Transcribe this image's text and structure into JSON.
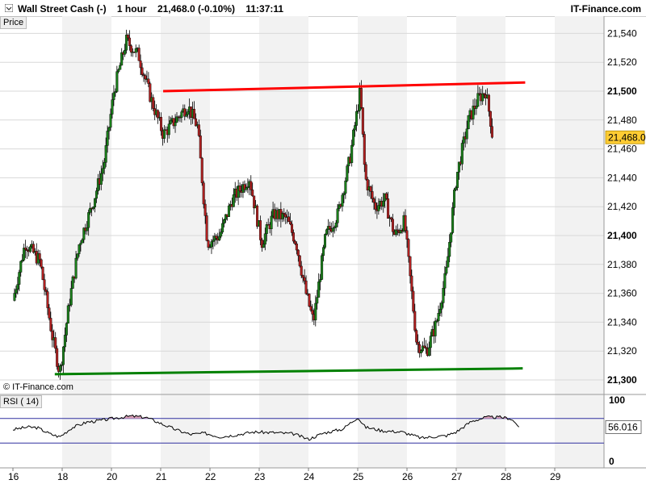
{
  "header": {
    "instrument": "Wall Street Cash (-)",
    "timeframe": "1 hour",
    "last_quote": "21,468.0 (-0.10%)",
    "time": "11:37:11",
    "brand": "IT-Finance.com"
  },
  "panels": {
    "price_label": "Price",
    "rsi_label": "RSI ( 14)",
    "copyright": "© IT-Finance.com"
  },
  "colors": {
    "up_candle": "#1a7f1a",
    "down_candle": "#b02020",
    "resistance": "#ff0000",
    "support": "#008000",
    "rsi_line": "#000000",
    "rsi_fill": "#d9a0b8",
    "rsi_band": "#3030a0",
    "last_price_badge": "#ffcc33",
    "session_shade": "#f2f2f2",
    "grid": "#d8d8d8"
  },
  "chart_data": [
    {
      "type": "candlestick",
      "title": "",
      "ylabel": "",
      "ylim": [
        21290,
        21555
      ],
      "y_ticks": [
        21300,
        21320,
        21340,
        21360,
        21380,
        21400,
        21420,
        21440,
        21460,
        21480,
        21500,
        21520,
        21540
      ],
      "y_tick_labels": [
        "21,300",
        "21,320",
        "21,340",
        "21,360",
        "21,380",
        "21,400",
        "21,420",
        "21,440",
        "21,460",
        "21,480",
        "21,500",
        "21,520",
        "21,540"
      ],
      "bold_ticks": [
        21300,
        21400,
        21500
      ],
      "x_ticks": [
        "16",
        "18",
        "20",
        "21",
        "22",
        "23",
        "24",
        "25",
        "26",
        "27",
        "28",
        "29"
      ],
      "x_range": [
        0,
        12
      ],
      "last_price": 21468.0,
      "last_price_label": "21,468.0",
      "path": [
        [
          0.0,
          21355
        ],
        [
          0.25,
          21395
        ],
        [
          0.55,
          21382
        ],
        [
          0.8,
          21330
        ],
        [
          0.95,
          21305
        ],
        [
          1.15,
          21355
        ],
        [
          1.35,
          21395
        ],
        [
          1.6,
          21420
        ],
        [
          1.85,
          21450
        ],
        [
          2.05,
          21500
        ],
        [
          2.3,
          21535
        ],
        [
          2.55,
          21525
        ],
        [
          2.8,
          21495
        ],
        [
          3.05,
          21470
        ],
        [
          3.3,
          21480
        ],
        [
          3.55,
          21490
        ],
        [
          3.75,
          21475
        ],
        [
          3.95,
          21395
        ],
        [
          4.2,
          21400
        ],
        [
          4.45,
          21425
        ],
        [
          4.8,
          21440
        ],
        [
          5.05,
          21395
        ],
        [
          5.3,
          21415
        ],
        [
          5.55,
          21412
        ],
        [
          5.75,
          21395
        ],
        [
          5.95,
          21360
        ],
        [
          6.1,
          21340
        ],
        [
          6.35,
          21400
        ],
        [
          6.6,
          21415
        ],
        [
          6.85,
          21455
        ],
        [
          7.05,
          21500
        ],
        [
          7.15,
          21440
        ],
        [
          7.35,
          21420
        ],
        [
          7.55,
          21425
        ],
        [
          7.75,
          21400
        ],
        [
          7.95,
          21410
        ],
        [
          8.05,
          21375
        ],
        [
          8.2,
          21325
        ],
        [
          8.4,
          21320
        ],
        [
          8.6,
          21340
        ],
        [
          8.8,
          21375
        ],
        [
          9.0,
          21440
        ],
        [
          9.25,
          21480
        ],
        [
          9.45,
          21495
        ],
        [
          9.6,
          21500
        ],
        [
          9.75,
          21468
        ]
      ],
      "trendlines": [
        {
          "name": "resistance",
          "from": [
            3.05,
            21500
          ],
          "to": [
            10.4,
            21506
          ]
        },
        {
          "name": "support",
          "from": [
            0.85,
            21304
          ],
          "to": [
            10.35,
            21308
          ]
        }
      ]
    },
    {
      "type": "line",
      "title": "",
      "ylabel": "",
      "ylim": [
        0,
        100
      ],
      "y_ticks": [
        0,
        100
      ],
      "y_tick_labels": [
        "0",
        "100"
      ],
      "bands": [
        30,
        70
      ],
      "last_value": 56.016,
      "last_value_label": "56.016",
      "path": [
        [
          0.0,
          52
        ],
        [
          0.3,
          56
        ],
        [
          0.5,
          55
        ],
        [
          0.75,
          45
        ],
        [
          0.95,
          40
        ],
        [
          1.2,
          55
        ],
        [
          1.5,
          64
        ],
        [
          1.8,
          67
        ],
        [
          2.1,
          71
        ],
        [
          2.4,
          74
        ],
        [
          2.7,
          72
        ],
        [
          3.0,
          62
        ],
        [
          3.3,
          52
        ],
        [
          3.6,
          44
        ],
        [
          3.9,
          46
        ],
        [
          4.2,
          40
        ],
        [
          4.5,
          43
        ],
        [
          4.9,
          48
        ],
        [
          5.3,
          47
        ],
        [
          5.7,
          45
        ],
        [
          6.0,
          36
        ],
        [
          6.3,
          46
        ],
        [
          6.7,
          53
        ],
        [
          7.0,
          72
        ],
        [
          7.15,
          56
        ],
        [
          7.5,
          50
        ],
        [
          7.9,
          48
        ],
        [
          8.3,
          38
        ],
        [
          8.5,
          40
        ],
        [
          8.8,
          42
        ],
        [
          9.0,
          48
        ],
        [
          9.3,
          65
        ],
        [
          9.6,
          72
        ],
        [
          9.9,
          72
        ],
        [
          10.1,
          70
        ],
        [
          10.3,
          56
        ]
      ]
    }
  ]
}
